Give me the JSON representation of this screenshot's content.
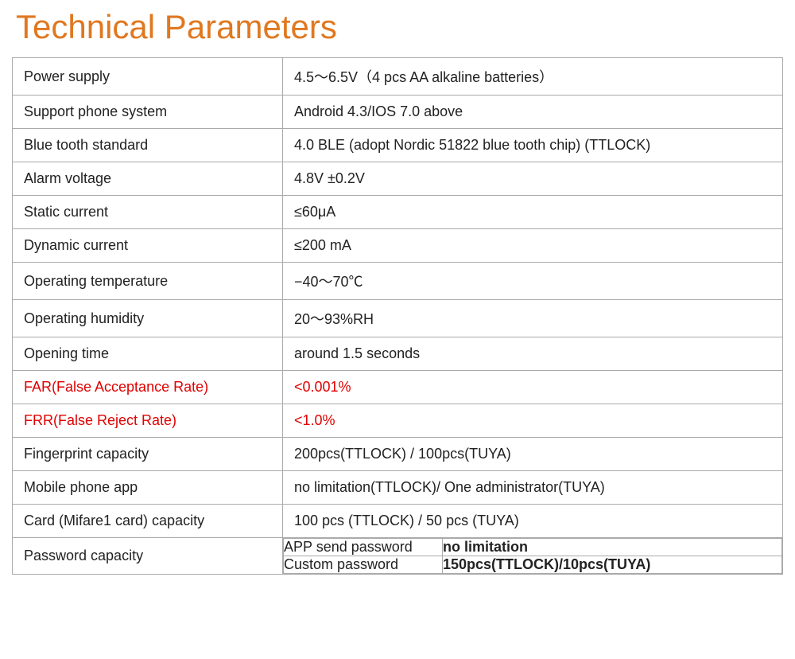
{
  "title": "Technical Parameters",
  "rows": [
    {
      "label": "Power supply",
      "value": "4.5～6.5V（4 pcs AA alkaline batteries）",
      "red": false
    },
    {
      "label": "Support phone system",
      "value": "Android 4.3/IOS 7.0 above",
      "red": false
    },
    {
      "label": "Blue tooth standard",
      "value": "4.0 BLE (adopt Nordic 51822 blue tooth chip) (TTLOCK)",
      "red": false
    },
    {
      "label": "Alarm voltage",
      "value": "4.8V  ±0.2V",
      "red": false
    },
    {
      "label": "Static current",
      "value": "≤60μA",
      "red": false
    },
    {
      "label": "Dynamic current",
      "value": "≤200 mA",
      "red": false
    },
    {
      "label": "Operating temperature",
      "value": "−40～70℃",
      "red": false
    },
    {
      "label": "Operating humidity",
      "value": "20～93%RH",
      "red": false
    },
    {
      "label": "Opening time",
      "value": "around 1.5 seconds",
      "red": false
    },
    {
      "label": "FAR(False Acceptance Rate)",
      "value": "<0.001%",
      "red": true
    },
    {
      "label": "FRR(False Reject Rate)",
      "value": "<1.0%",
      "red": true
    },
    {
      "label": "Fingerprint capacity",
      "value": "200pcs(TTLOCK) / 100pcs(TUYA)",
      "red": false
    },
    {
      "label": "Mobile phone app",
      "value": "no limitation(TTLOCK)/ One administrator(TUYA)",
      "red": false
    },
    {
      "label": "Card (Mifare1 card) capacity",
      "value": "100 pcs (TTLOCK) / 50 pcs (TUYA)",
      "red": false
    }
  ],
  "password_row": {
    "label": "Password capacity",
    "sub_rows": [
      {
        "sub_label": "APP send password",
        "sub_value": "no limitation"
      },
      {
        "sub_label": "Custom password",
        "sub_value": "150pcs(TTLOCK)/10pcs(TUYA)"
      }
    ]
  }
}
